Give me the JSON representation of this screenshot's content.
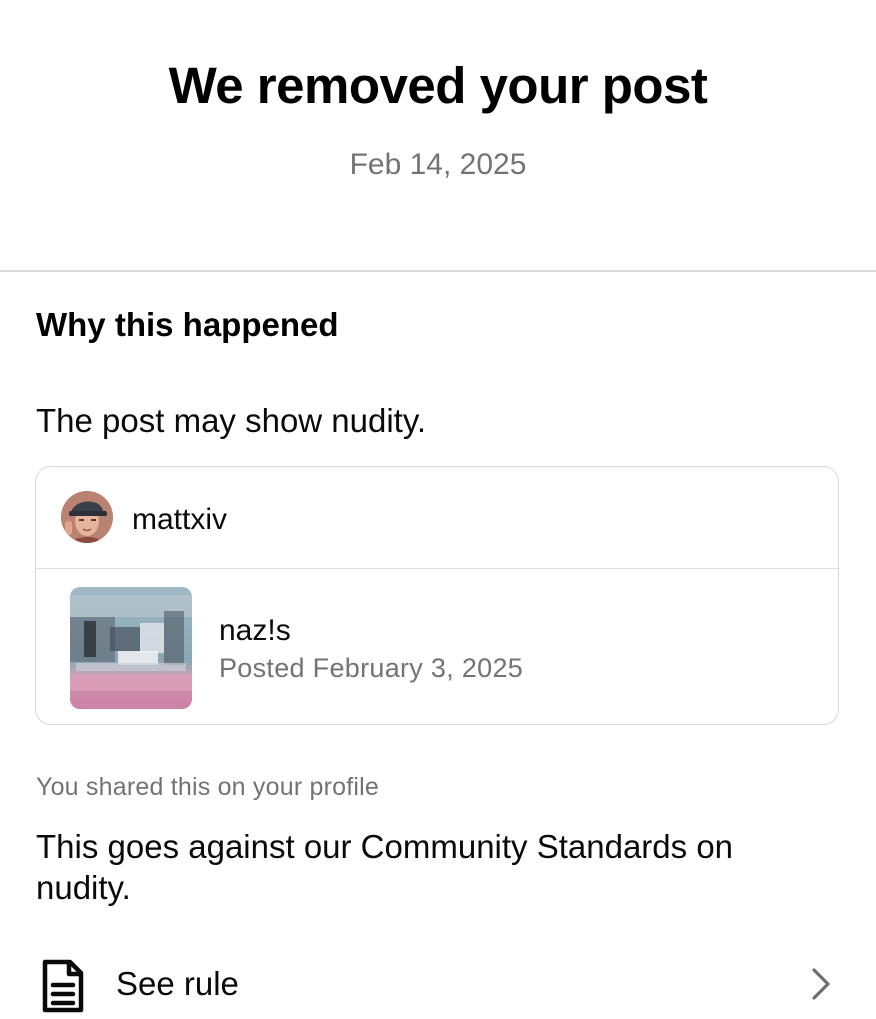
{
  "header": {
    "title": "We removed your post",
    "date": "Feb 14, 2025"
  },
  "why": {
    "heading": "Why this happened",
    "reason": "The post may show nudity."
  },
  "post_card": {
    "username": "mattxiv",
    "avatar_icon": "user-avatar",
    "thumbnail_icon": "post-thumbnail",
    "post_text": "naz!s",
    "posted_date": "Posted February 3, 2025"
  },
  "shared_note": "You shared this on your profile",
  "standards_text": "This goes against our Community Standards on nudity.",
  "see_rule": {
    "label": "See rule",
    "icon": "document-icon",
    "chevron": "chevron-right-icon"
  },
  "colors": {
    "primary_text": "#0a0a0a",
    "secondary_text": "#737373",
    "divider": "#dadada",
    "card_border": "#d9d9d9"
  }
}
